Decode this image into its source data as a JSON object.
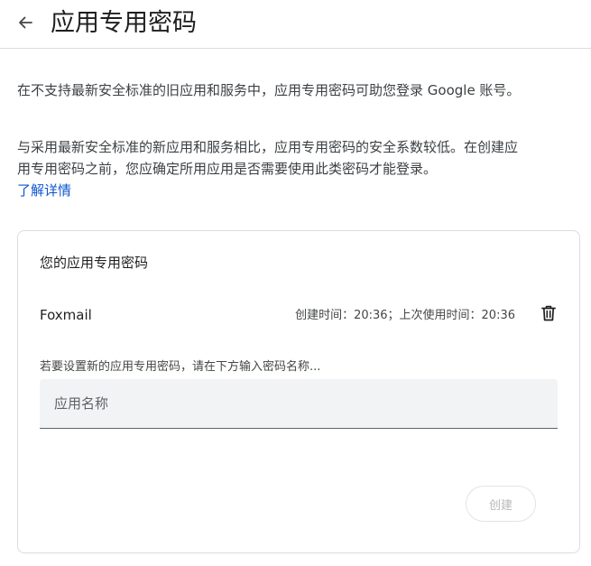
{
  "header": {
    "back_icon": "arrow-back-icon",
    "title": "应用专用密码"
  },
  "intro": {
    "paragraph1": "在不支持最新安全标准的旧应用和服务中，应用专用密码可助您登录 Google 账号。",
    "paragraph2": "与采用最新安全标准的新应用和服务相比，应用专用密码的安全系数较低。在创建应用专用密码之前，您应确定所用应用是否需要使用此类密码才能登录。",
    "learn_more": "了解详情"
  },
  "card": {
    "title": "您的应用专用密码",
    "passwords": [
      {
        "name": "Foxmail",
        "meta": "创建时间：20:36；上次使用时间：20:36",
        "delete_icon": "trash-icon"
      }
    ],
    "new_hint": "若要设置新的应用专用密码，请在下方输入密码名称...",
    "name_placeholder": "应用名称",
    "name_value": "",
    "create_label": "创建"
  },
  "colors": {
    "link": "#0b57d0",
    "text": "#1f1f1f",
    "secondary_text": "#444746",
    "field_bg": "#f1f3f4",
    "disabled_text": "#b8b8b8"
  }
}
